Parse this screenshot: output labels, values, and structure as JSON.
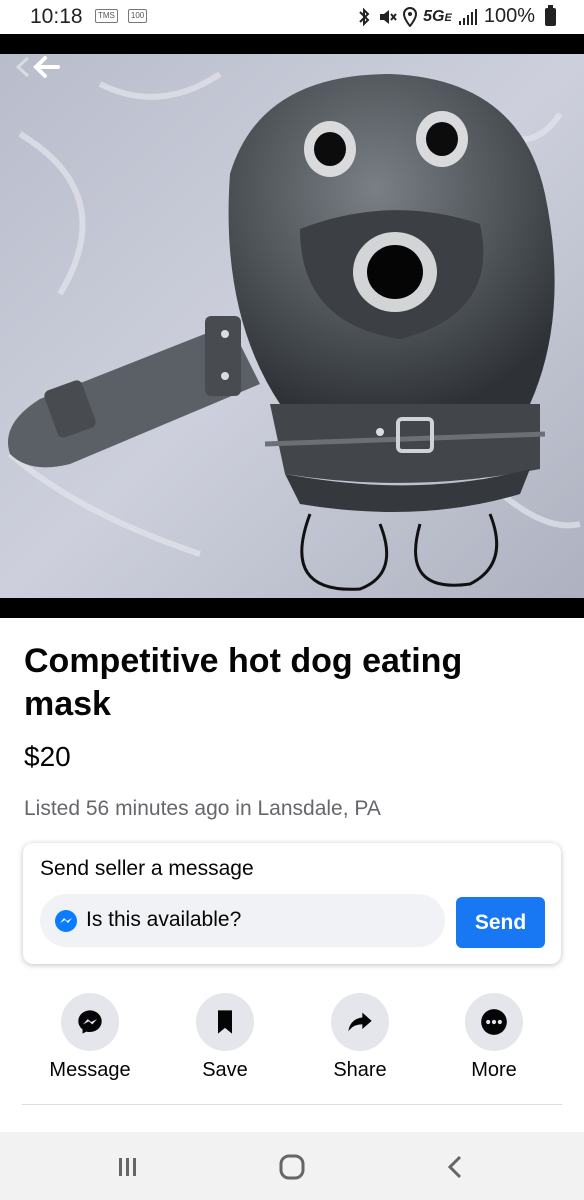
{
  "status_bar": {
    "time": "10:18",
    "network": "5G",
    "network_suffix": "E",
    "battery": "100%",
    "tiny_icon_1": "TMS",
    "tiny_icon_2": "100"
  },
  "listing": {
    "title": "Competitive hot dog eating mask",
    "price": "$20",
    "listed": "Listed 56 minutes ago in Lansdale, PA"
  },
  "message_box": {
    "heading": "Send seller a message",
    "input_value": "Is this available?",
    "send_label": "Send"
  },
  "actions": [
    {
      "label": "Message",
      "icon": "messenger-icon"
    },
    {
      "label": "Save",
      "icon": "bookmark-icon"
    },
    {
      "label": "Share",
      "icon": "share-arrow-icon"
    },
    {
      "label": "More",
      "icon": "more-dots-icon"
    }
  ],
  "colors": {
    "accent": "#1877f2",
    "secondary_text": "#65676b",
    "button_bg": "#e4e6eb"
  }
}
